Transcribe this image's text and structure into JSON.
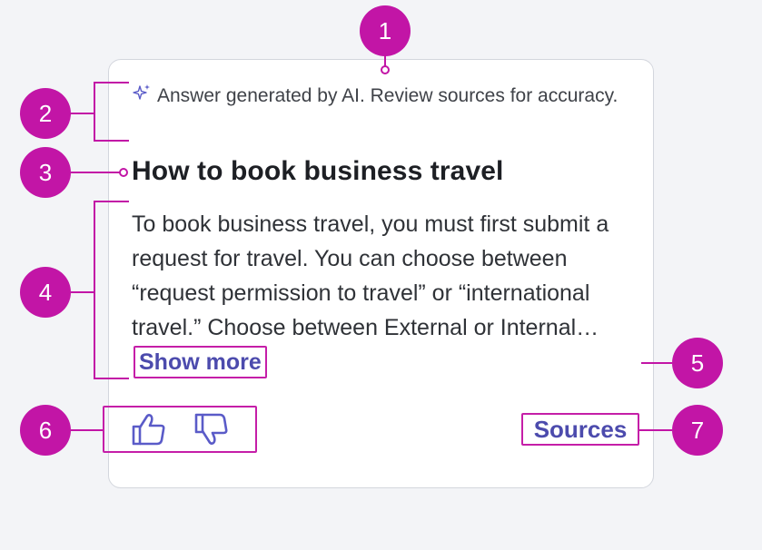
{
  "card": {
    "disclaimer": "Answer generated by AI. Review sources for accuracy.",
    "title": "How to book business travel",
    "body": "To book business travel, you must first submit a request for travel. You can choose between “request permission to travel” or “international travel.” Choose between External or Internal…",
    "show_more_label": "Show more",
    "sources_label": "Sources",
    "feedback": {
      "thumbs_up_icon": "thumbs-up-icon",
      "thumbs_down_icon": "thumbs-down-icon"
    },
    "sparkle_icon": "sparkle-icon"
  },
  "annotations": {
    "markers": [
      "1",
      "2",
      "3",
      "4",
      "5",
      "6",
      "7"
    ]
  },
  "colors": {
    "marker": "#c215a6",
    "link": "#4c4bad",
    "accent_icon": "#5a5bc8",
    "card_border": "#d3d6dd",
    "background": "#f3f4f7"
  }
}
